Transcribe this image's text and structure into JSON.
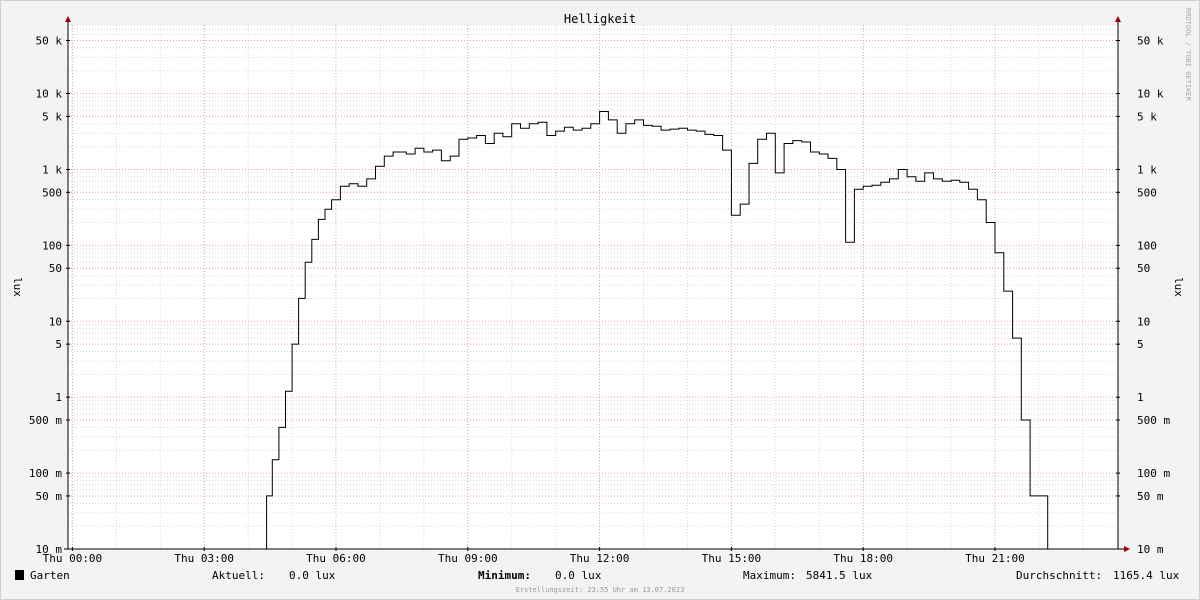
{
  "chart_data": {
    "type": "line",
    "title": "Helligkeit",
    "ylabel": "lux",
    "watermark": "RRDTOOL / TOBI OETIKER",
    "y_scale": "log",
    "ylim": [
      0.01,
      80000
    ],
    "xlim_hours": [
      -0.1,
      23.8
    ],
    "x_ticks": [
      {
        "h": 0,
        "label": "Thu 00:00"
      },
      {
        "h": 3,
        "label": "Thu 03:00"
      },
      {
        "h": 6,
        "label": "Thu 06:00"
      },
      {
        "h": 9,
        "label": "Thu 09:00"
      },
      {
        "h": 12,
        "label": "Thu 12:00"
      },
      {
        "h": 15,
        "label": "Thu 15:00"
      },
      {
        "h": 18,
        "label": "Thu 18:00"
      },
      {
        "h": 21,
        "label": "Thu 21:00"
      }
    ],
    "y_ticks": [
      {
        "v": 0.01,
        "label": "10 m"
      },
      {
        "v": 0.05,
        "label": "50 m"
      },
      {
        "v": 0.1,
        "label": "100 m"
      },
      {
        "v": 0.5,
        "label": "500 m"
      },
      {
        "v": 1,
        "label": "1"
      },
      {
        "v": 5,
        "label": "5"
      },
      {
        "v": 10,
        "label": "10"
      },
      {
        "v": 50,
        "label": "50"
      },
      {
        "v": 100,
        "label": "100"
      },
      {
        "v": 500,
        "label": "500"
      },
      {
        "v": 1000,
        "label": "1 k"
      },
      {
        "v": 5000,
        "label": "5 k"
      },
      {
        "v": 10000,
        "label": "10 k"
      },
      {
        "v": 50000,
        "label": "50 k"
      }
    ],
    "series": [
      {
        "name": "Garten",
        "color": "#000000",
        "x_hours": [
          0,
          4.4,
          4.42,
          4.55,
          4.7,
          4.85,
          5.0,
          5.15,
          5.3,
          5.45,
          5.6,
          5.75,
          5.9,
          6.1,
          6.3,
          6.5,
          6.7,
          6.9,
          7.1,
          7.3,
          7.6,
          7.8,
          8.0,
          8.2,
          8.4,
          8.6,
          8.8,
          9.0,
          9.2,
          9.4,
          9.6,
          9.8,
          10.0,
          10.2,
          10.4,
          10.6,
          10.8,
          11.0,
          11.2,
          11.4,
          11.6,
          11.8,
          12.0,
          12.2,
          12.4,
          12.6,
          12.8,
          13.0,
          13.2,
          13.4,
          13.6,
          13.8,
          14.0,
          14.2,
          14.4,
          14.6,
          14.8,
          15.0,
          15.2,
          15.4,
          15.6,
          15.8,
          16.0,
          16.2,
          16.4,
          16.6,
          16.8,
          17.0,
          17.2,
          17.4,
          17.6,
          17.8,
          18.0,
          18.2,
          18.4,
          18.6,
          18.8,
          19.0,
          19.2,
          19.4,
          19.6,
          19.8,
          20.0,
          20.2,
          20.4,
          20.6,
          20.8,
          21.0,
          21.2,
          21.4,
          21.6,
          21.8,
          22.0,
          22.2,
          22.4,
          22.55,
          22.7,
          22.75,
          23.0,
          23.75
        ],
        "values": [
          0.01,
          0.01,
          0.05,
          0.15,
          0.4,
          1.2,
          5,
          20,
          60,
          120,
          220,
          300,
          400,
          600,
          650,
          600,
          750,
          1100,
          1500,
          1700,
          1600,
          1900,
          1700,
          1800,
          1300,
          1500,
          2500,
          2600,
          2800,
          2200,
          3000,
          2700,
          4000,
          3500,
          4000,
          4200,
          2800,
          3200,
          3600,
          3300,
          3500,
          4000,
          5800,
          4500,
          3000,
          4000,
          4500,
          3800,
          3700,
          3300,
          3400,
          3500,
          3300,
          3200,
          2900,
          2800,
          1800,
          250,
          350,
          1200,
          2500,
          3000,
          900,
          2200,
          2400,
          2300,
          1700,
          1600,
          1400,
          1000,
          110,
          550,
          600,
          620,
          680,
          750,
          1000,
          800,
          700,
          900,
          750,
          700,
          720,
          680,
          550,
          400,
          200,
          80,
          25,
          6,
          0.5,
          0.05,
          0.05,
          0.01,
          0.01
        ]
      }
    ],
    "legend": {
      "series": "Garten",
      "aktuell_label": "Aktuell:",
      "aktuell_value": "0.0 lux",
      "minimum_label": "Minimum:",
      "minimum_value": "0.0 lux",
      "maximum_label": "Maximum:",
      "maximum_value": "5841.5 lux",
      "durchschnitt_label": "Durchschnitt:",
      "durchschnitt_value": "1165.4 lux"
    },
    "footer": "Erstellungszeit: 23:55 Uhr am 13.07.2023",
    "colors": {
      "background": "#f3f3f3",
      "plot_bg": "#ffffff",
      "major_grid": "#e8a0a0",
      "minor_grid": "#d8d8d8",
      "axis": "#000000",
      "arrow": "#990000"
    }
  }
}
